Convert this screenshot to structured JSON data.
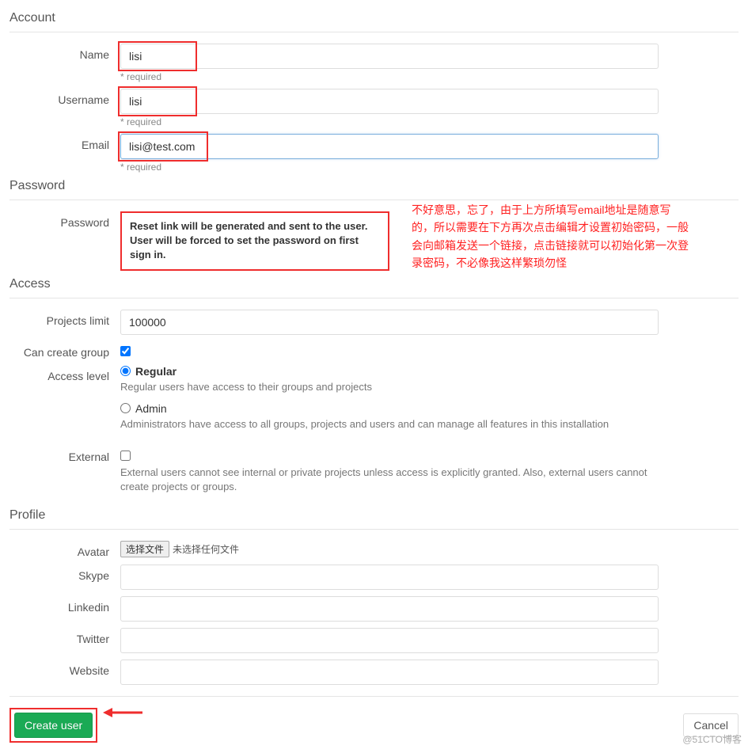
{
  "sections": {
    "account": "Account",
    "password": "Password",
    "access": "Access",
    "profile": "Profile"
  },
  "account": {
    "name_label": "Name",
    "name_value": "lisi",
    "name_helper": "* required",
    "username_label": "Username",
    "username_value": "lisi",
    "username_helper": "* required",
    "email_label": "Email",
    "email_value": "lisi@test.com",
    "email_helper": "* required"
  },
  "password": {
    "label": "Password",
    "line1": "Reset link will be generated and sent to the user.",
    "line2": "User will be forced to set the password on first sign in."
  },
  "access": {
    "projects_limit_label": "Projects limit",
    "projects_limit_value": "100000",
    "can_create_group_label": "Can create group",
    "can_create_group_checked": true,
    "access_level_label": "Access level",
    "regular_label": "Regular",
    "regular_desc": "Regular users have access to their groups and projects",
    "admin_label": "Admin",
    "admin_desc": "Administrators have access to all groups, projects and users and can manage all features in this installation",
    "external_label": "External",
    "external_checked": false,
    "external_desc": "External users cannot see internal or private projects unless access is explicitly granted. Also, external users cannot create projects or groups."
  },
  "profile": {
    "avatar_label": "Avatar",
    "avatar_button": "选择文件",
    "avatar_nofile": "未选择任何文件",
    "skype_label": "Skype",
    "skype_value": "",
    "linkedin_label": "Linkedin",
    "linkedin_value": "",
    "twitter_label": "Twitter",
    "twitter_value": "",
    "website_label": "Website",
    "website_value": ""
  },
  "footer": {
    "create_label": "Create user",
    "cancel_label": "Cancel"
  },
  "note": "不好意思，忘了，由于上方所填写email地址是随意写的，所以需要在下方再次点击编辑才设置初始密码，一般会向邮箱发送一个链接，点击链接就可以初始化第一次登录密码，不必像我这样繁琐勿怪",
  "watermark": "@51CTO博客"
}
